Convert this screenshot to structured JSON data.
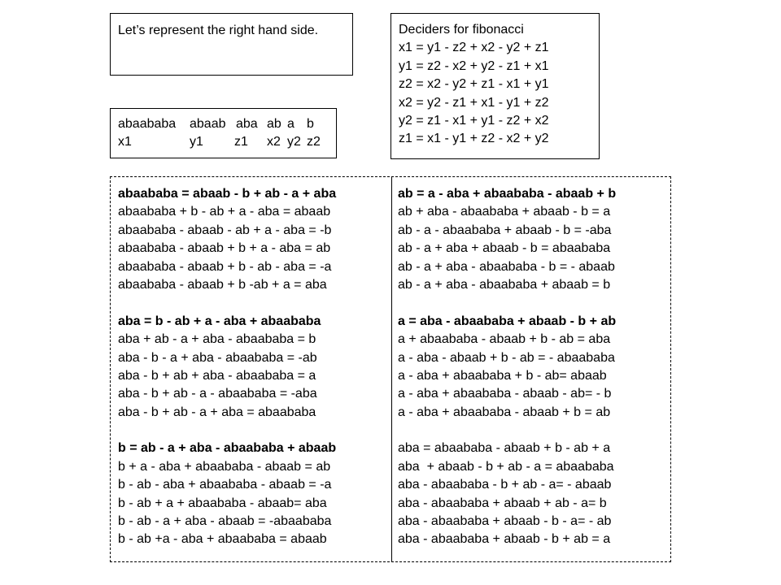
{
  "intro": {
    "text": "Let’s represent the right hand side."
  },
  "deciders": {
    "title": "Deciders for fibonacci",
    "lines": [
      "x1 = y1 - z2 + x2 - y2 + z1",
      "y1 = z2 - x2 + y2 - z1 + x1",
      "z2 = x2 - y2 + z1 - x1 + y1",
      "x2 = y2 - z1 + x1 - y1 + z2",
      "y2 = z1 - x1 + y1 - z2 + x2",
      "z1 = x1 - y1 + z2 - x2 + y2"
    ]
  },
  "mapping": {
    "words": [
      "abaababa",
      "abaab",
      "aba",
      "ab",
      "a",
      "b"
    ],
    "vars": [
      "x1",
      "y1",
      "z1",
      "x2",
      "y2",
      "z2"
    ]
  },
  "left_column": {
    "groups": [
      {
        "heading": "abaababa = abaab - b + ab - a + aba",
        "lines": [
          "abaababa + b - ab + a - aba = abaab",
          "abaababa - abaab - ab + a - aba = -b",
          "abaababa - abaab + b + a - aba = ab",
          "abaababa - abaab + b - ab - aba = -a",
          "abaababa - abaab + b -ab + a = aba"
        ]
      },
      {
        "heading": "aba = b - ab + a - aba + abaababa",
        "lines": [
          "aba + ab - a + aba - abaababa = b",
          "aba - b - a + aba - abaababa = -ab",
          "aba - b + ab + aba - abaababa = a",
          "aba - b + ab - a - abaababa = -aba",
          "aba - b + ab - a + aba = abaababa"
        ]
      },
      {
        "heading": "b = ab - a + aba - abaababa + abaab",
        "lines": [
          "b + a - aba + abaababa - abaab = ab",
          "b - ab - aba + abaababa - abaab = -a",
          "b - ab + a + abaababa - abaab= aba",
          "b - ab - a + aba - abaab = -abaababa",
          "b - ab +a - aba + abaababa = abaab"
        ]
      }
    ]
  },
  "right_column": {
    "groups": [
      {
        "heading": "ab = a - aba + abaababa - abaab + b",
        "bold": true,
        "lines": [
          "ab + aba - abaababa + abaab - b = a",
          "ab - a - abaababa + abaab - b = -aba",
          "ab - a + aba + abaab - b = abaababa",
          "ab - a + aba - abaababa - b = - abaab",
          "ab - a + aba - abaababa + abaab = b"
        ]
      },
      {
        "heading": "a = aba - abaababa + abaab - b + ab",
        "bold": true,
        "lines": [
          "a + abaababa - abaab + b - ab = aba",
          "a - aba - abaab + b - ab = - abaababa",
          "a - aba + abaababa + b - ab= abaab",
          "a - aba + abaababa - abaab - ab= - b",
          "a - aba + abaababa - abaab + b = ab"
        ]
      },
      {
        "heading": "aba = abaababa - abaab + b - ab + a",
        "bold": false,
        "lines": [
          "aba  + abaab - b + ab - a = abaababa",
          "aba - abaababa - b + ab - a= - abaab",
          "aba - abaababa + abaab + ab - a= b",
          "aba - abaababa + abaab - b - a= - ab",
          "aba - abaababa + abaab - b + ab = a"
        ]
      }
    ]
  }
}
